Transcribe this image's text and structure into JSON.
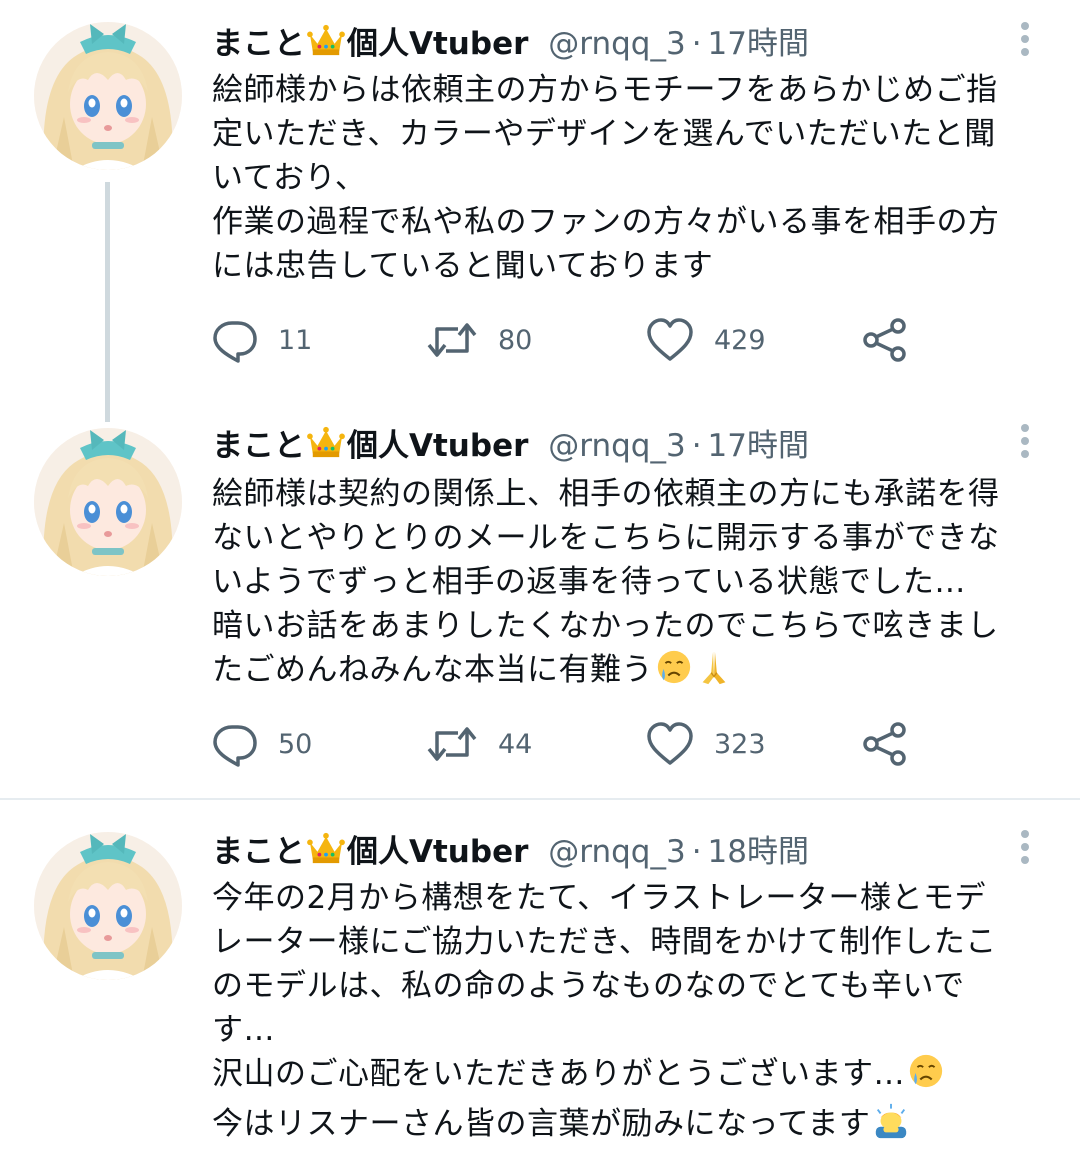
{
  "tweets": [
    {
      "name": "まこと",
      "name_suffix": "個人Vtuber",
      "handle": "@rnqq_3",
      "separator": "·",
      "time": "17時間",
      "lines": [
        "絵師様からは依頼主の方からモチーフをあらかじめご指",
        "定いただき、カラーやデザインを選んでいただいたと聞",
        "いており、",
        "作業の過程で私や私のファンの方々がいる事を相手の方",
        "には忠告していると聞いております"
      ],
      "replies": "11",
      "retweets": "80",
      "likes": "429"
    },
    {
      "name": "まこと",
      "name_suffix": "個人Vtuber",
      "handle": "@rnqq_3",
      "separator": "·",
      "time": "17時間",
      "lines": [
        "絵師様は契約の関係上、相手の依頼主の方にも承諾を得",
        "ないとやりとりのメールをこちらに開示する事ができな",
        "いようでずっと相手の返事を待っている状態でした…",
        "暗いお話をあまりしたくなかったのでこちらで呟きまし",
        "たごめんねみんな本当に有難う"
      ],
      "replies": "50",
      "retweets": "44",
      "likes": "323"
    },
    {
      "name": "まこと",
      "name_suffix": "個人Vtuber",
      "handle": "@rnqq_3",
      "separator": "·",
      "time": "18時間",
      "lines": [
        "今年の2月から構想をたて、イラストレーター様とモデ",
        "レーター様にご協力いただき、時間をかけて制作したこ",
        "のモデルは、私の命のようなものなのでとても辛いで",
        "す…",
        "沢山のご心配をいただきありがとうございます…",
        "今はリスナーさん皆の言葉が励みになってます"
      ]
    }
  ],
  "colors": {
    "text": "#0f1419",
    "secondary": "#536471",
    "thread_line": "#cfd9de",
    "divider": "#e6ecf0",
    "menu_dots": "#aab8c2"
  },
  "icons": {
    "reply": "speech-bubble-icon",
    "retweet": "retweet-icon",
    "like": "heart-icon",
    "share": "share-icon",
    "more": "vertical-dots-icon",
    "name_badge": "crown-emoji",
    "emojis": [
      "crying-face-emoji",
      "folded-hands-emoji",
      "person-bowing-emoji"
    ]
  }
}
